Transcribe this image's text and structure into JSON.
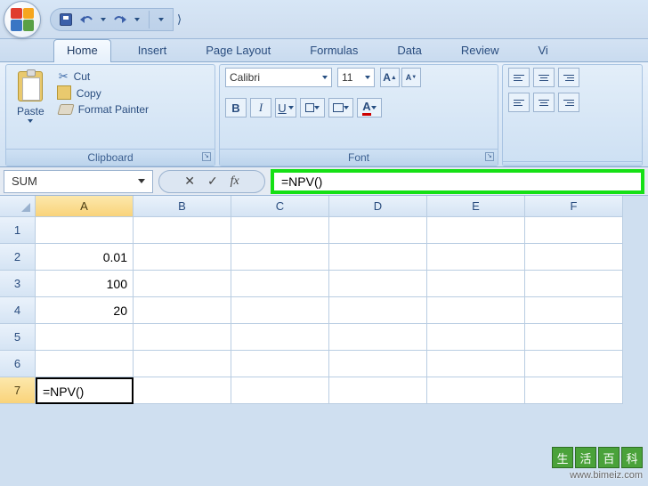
{
  "qat": {
    "undo_tip": "Undo",
    "redo_tip": "Redo",
    "save_tip": "Save"
  },
  "tabs": {
    "home": "Home",
    "insert": "Insert",
    "page_layout": "Page Layout",
    "formulas": "Formulas",
    "data": "Data",
    "review": "Review",
    "view": "Vi"
  },
  "ribbon": {
    "clipboard": {
      "label": "Clipboard",
      "paste": "Paste",
      "cut": "Cut",
      "copy": "Copy",
      "format_painter": "Format Painter"
    },
    "font": {
      "label": "Font",
      "font_name": "Calibri",
      "font_size": "11",
      "bold": "B",
      "italic": "I",
      "underline": "U",
      "grow": "A",
      "shrink": "A",
      "font_color_letter": "A"
    },
    "alignment": {
      "label": ""
    }
  },
  "formula_bar": {
    "name_box": "SUM",
    "cancel": "✕",
    "enter": "✓",
    "fx": "fx",
    "formula": "=NPV()"
  },
  "sheet": {
    "columns": [
      "A",
      "B",
      "C",
      "D",
      "E",
      "F"
    ],
    "rows": [
      "1",
      "2",
      "3",
      "4",
      "5",
      "6",
      "7"
    ],
    "active_col": "A",
    "active_row": "7",
    "cells": {
      "A2": "0.01",
      "A3": "100",
      "A4": "20",
      "A7": "=NPV()"
    }
  },
  "watermark": {
    "chars": [
      "生",
      "活",
      "百",
      "科"
    ],
    "url": "www.bimeiz.com"
  }
}
